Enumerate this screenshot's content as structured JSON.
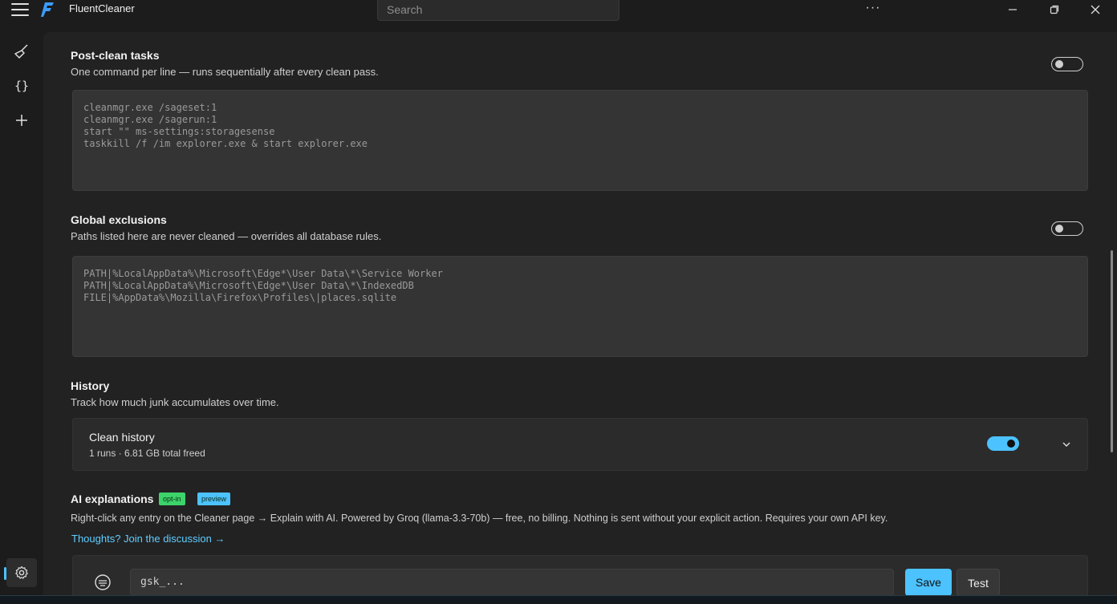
{
  "app": {
    "title": "FluentCleaner",
    "search_placeholder": "Search"
  },
  "colors": {
    "accent": "#4cc2ff",
    "link": "#60cdff",
    "badge_green": "#3dd36b",
    "badge_blue": "#4cc2ff"
  },
  "sidebar": {
    "items": [
      {
        "icon": "broom-icon",
        "label": "Cleaner"
      },
      {
        "icon": "braces-icon",
        "label": "Rules"
      },
      {
        "icon": "plus-icon",
        "label": "Add"
      },
      {
        "icon": "gear-icon",
        "label": "Settings",
        "selected": true
      }
    ]
  },
  "post_clean": {
    "title": "Post-clean tasks",
    "subtitle": "One command per line — runs sequentially after every clean pass.",
    "toggle_on": false,
    "lines": [
      "cleanmgr.exe /sageset:1",
      "cleanmgr.exe /sagerun:1",
      "start \"\" ms-settings:storagesense",
      "taskkill /f /im explorer.exe & start explorer.exe"
    ]
  },
  "exclusions": {
    "title": "Global exclusions",
    "subtitle": "Paths listed here are never cleaned — overrides all database rules.",
    "toggle_on": false,
    "lines": [
      "PATH|%LocalAppData%\\Microsoft\\Edge*\\User Data\\*\\Service Worker",
      "PATH|%LocalAppData%\\Microsoft\\Edge*\\User Data\\*\\IndexedDB",
      "FILE|%AppData%\\Mozilla\\Firefox\\Profiles\\|places.sqlite"
    ]
  },
  "history": {
    "title": "History",
    "subtitle": "Track how much junk accumulates over time.",
    "card_title": "Clean history",
    "card_sub": "1 runs · 6.81 GB total freed",
    "toggle_on": true
  },
  "ai": {
    "title": "AI explanations",
    "badge1": "opt-in",
    "badge2": "preview",
    "description": "Right-click any entry on the Cleaner page → Explain with AI. Powered by Groq (llama-3.3-70b) — free, no billing. Nothing is sent without your explicit action. Requires your own API key.",
    "link": "Thoughts? Join the discussion →",
    "api_key_value": "gsk_...",
    "save_label": "Save",
    "test_label": "Test"
  }
}
